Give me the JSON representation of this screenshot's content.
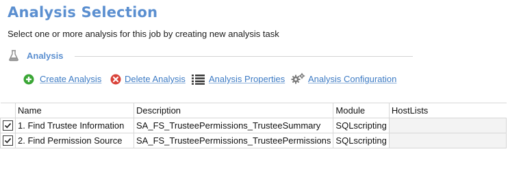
{
  "header": {
    "title": "Analysis Selection",
    "subtitle": "Select one or more analysis for this job by creating new analysis task"
  },
  "section": {
    "label": "Analysis",
    "icon": "flask-icon"
  },
  "toolbar": {
    "create_label": "Create Analysis",
    "delete_label": "Delete Analysis",
    "properties_label": "Analysis Properties",
    "configuration_label": "Analysis Configuration"
  },
  "table": {
    "columns": [
      "Name",
      "Description",
      "Module",
      "HostLists"
    ],
    "rows": [
      {
        "checked": true,
        "name": "1. Find Trustee Information",
        "description": "SA_FS_TrusteePermissions_TrusteeSummary",
        "module": "SQLscripting",
        "hostlists": ""
      },
      {
        "checked": true,
        "name": "2. Find Permission Source",
        "description": "SA_FS_TrusteePermissions_TrusteePermissions",
        "module": "SQLscripting",
        "hostlists": ""
      }
    ]
  },
  "colors": {
    "title": "#5b8fd0",
    "link": "#3d7bc4",
    "create_icon": "#3aa635",
    "delete_icon": "#d9433a"
  }
}
